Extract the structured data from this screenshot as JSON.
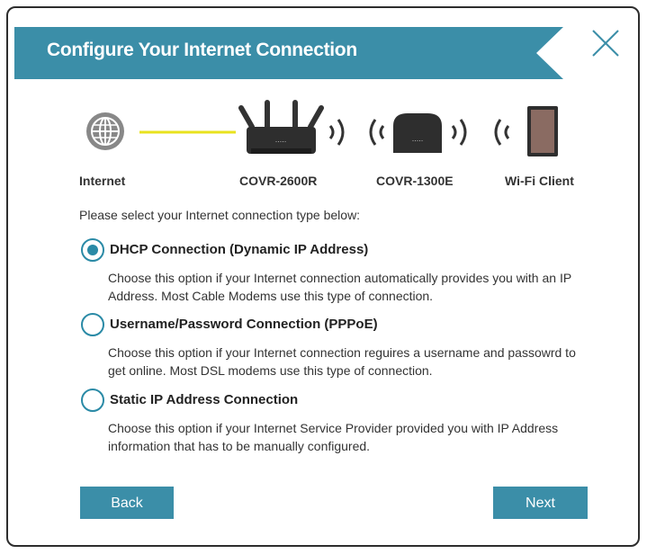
{
  "dialog": {
    "title": "Configure Your Internet Connection"
  },
  "diagram": {
    "labels": [
      "Internet",
      "COVR-2600R",
      "COVR-1300E",
      "Wi-Fi Client"
    ]
  },
  "intro": "Please select your Internet connection type below:",
  "options": [
    {
      "title": "DHCP Connection (Dynamic IP Address)",
      "description": "Choose this option if your Internet connection automatically provides you with an IP Address. Most Cable Modems use this type of connection.",
      "selected": true
    },
    {
      "title": "Username/Password Connection (PPPoE)",
      "description": "Choose this option if your Internet connection reguires a username and passowrd to get online. Most DSL modems use this type of connection.",
      "selected": false
    },
    {
      "title": "Static IP Address Connection",
      "description": "Choose this option if your Internet Service Provider provided you with IP Address information that has to be manually configured.",
      "selected": false
    }
  ],
  "buttons": {
    "back": "Back",
    "next": "Next"
  },
  "colors": {
    "accent": "#3b8ea8",
    "link_line": "#e8e21f"
  }
}
